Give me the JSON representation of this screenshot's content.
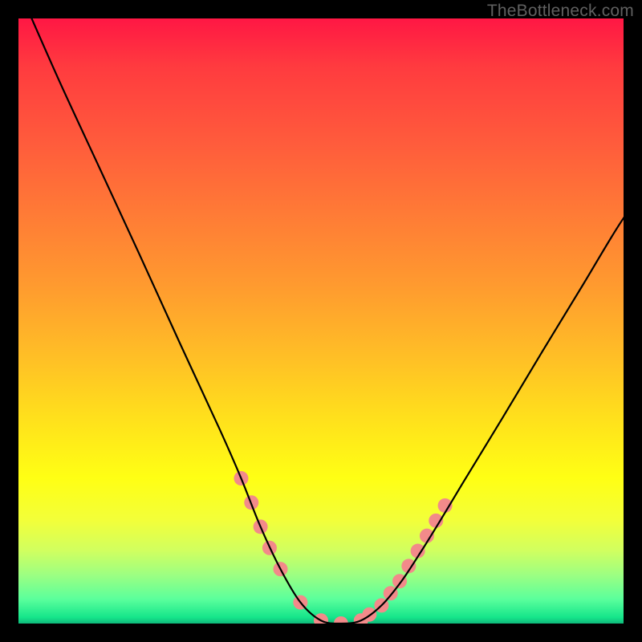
{
  "watermark": "TheBottleneck.com",
  "chart_data": {
    "type": "line",
    "title": "",
    "xlabel": "",
    "ylabel": "",
    "xlim": [
      0,
      100
    ],
    "ylim": [
      0,
      100
    ],
    "series": [
      {
        "name": "bottleneck-curve",
        "x": [
          0,
          6.6,
          13.3,
          20,
          26.6,
          33.3,
          36.8,
          40,
          43.3,
          46.6,
          50,
          53.3,
          56.6,
          60,
          63.3,
          66.6,
          70,
          73.3,
          80,
          86.6,
          93.3,
          100,
          105
        ],
        "values": [
          105,
          90,
          75.5,
          61,
          46.5,
          32,
          24,
          16,
          9,
          3.5,
          0.5,
          0,
          0.5,
          3,
          7,
          12,
          17.5,
          23,
          34,
          45,
          56,
          67,
          73
        ]
      }
    ],
    "markers": {
      "name": "highlight-dots",
      "x": [
        36.8,
        38.5,
        40,
        41.5,
        43.3,
        46.6,
        50,
        53.3,
        56.6,
        58,
        60,
        61.5,
        63,
        64.5,
        66,
        67.5,
        69,
        70.5
      ],
      "values": [
        24,
        20,
        16,
        12.5,
        9,
        3.5,
        0.5,
        0,
        0.5,
        1.5,
        3,
        5,
        7,
        9.5,
        12,
        14.5,
        17,
        19.5
      ],
      "color": "#f28a8a",
      "radius": 9
    },
    "background_gradient": {
      "top": "#ff1744",
      "mid": "#ffff14",
      "bottom": "#0fb87a"
    }
  }
}
